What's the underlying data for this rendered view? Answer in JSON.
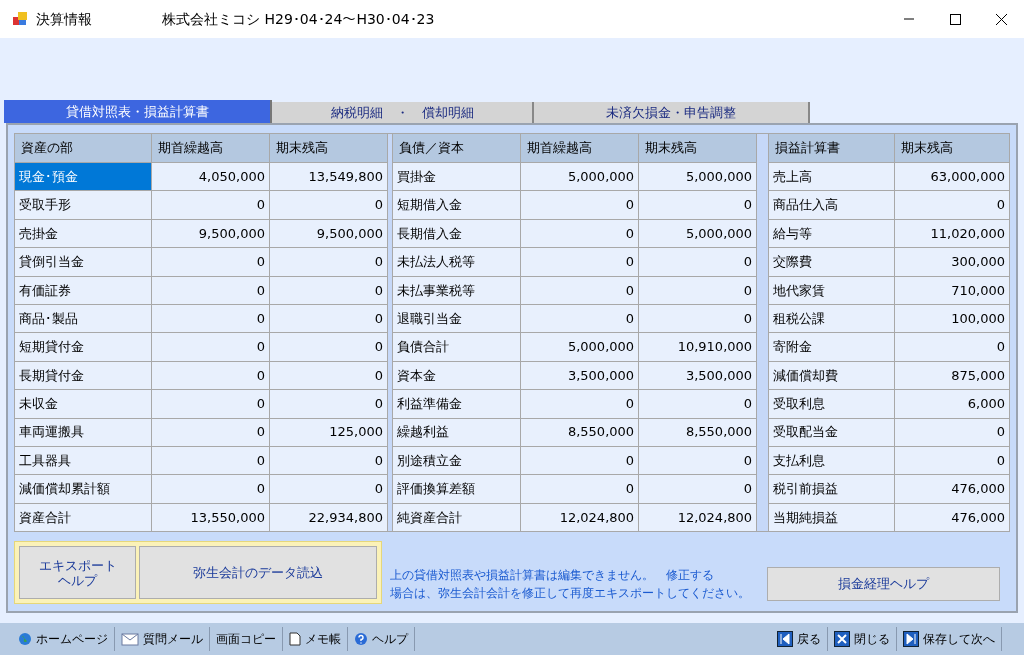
{
  "window": {
    "title": "決算情報",
    "subtitle": "株式会社ミコシ H29･04･24～H30･04･23"
  },
  "tabs": [
    {
      "label": "貸借対照表・損益計算書",
      "selected": true
    },
    {
      "label": "納税明細　・　償却明細",
      "selected": false
    },
    {
      "label": "未済欠損金・申告調整",
      "selected": false
    }
  ],
  "sections": [
    {
      "columns": [
        "資産の部",
        "期首繰越高",
        "期末残高"
      ],
      "rows": [
        {
          "name": "現金･預金",
          "values": [
            "4,050,000",
            "13,549,800"
          ],
          "selected": true
        },
        {
          "name": "受取手形",
          "values": [
            "0",
            "0"
          ],
          "selected": false
        },
        {
          "name": "売掛金",
          "values": [
            "9,500,000",
            "9,500,000"
          ],
          "selected": false
        },
        {
          "name": "貸倒引当金",
          "values": [
            "0",
            "0"
          ],
          "selected": false
        },
        {
          "name": "有価証券",
          "values": [
            "0",
            "0"
          ],
          "selected": false
        },
        {
          "name": "商品･製品",
          "values": [
            "0",
            "0"
          ],
          "selected": false
        },
        {
          "name": "短期貸付金",
          "values": [
            "0",
            "0"
          ],
          "selected": false
        },
        {
          "name": "長期貸付金",
          "values": [
            "0",
            "0"
          ],
          "selected": false
        },
        {
          "name": "未収金",
          "values": [
            "0",
            "0"
          ],
          "selected": false
        },
        {
          "name": "車両運搬具",
          "values": [
            "0",
            "125,000"
          ],
          "selected": false
        },
        {
          "name": "工具器具",
          "values": [
            "0",
            "0"
          ],
          "selected": false
        },
        {
          "name": "減価償却累計額",
          "values": [
            "0",
            "0"
          ],
          "selected": false
        },
        {
          "name": "資産合計",
          "values": [
            "13,550,000",
            "22,934,800"
          ],
          "selected": false
        }
      ]
    },
    {
      "columns": [
        "負債／資本",
        "期首繰越高",
        "期末残高"
      ],
      "rows": [
        {
          "name": "買掛金",
          "values": [
            "5,000,000",
            "5,000,000"
          ],
          "selected": false
        },
        {
          "name": "短期借入金",
          "values": [
            "0",
            "0"
          ],
          "selected": false
        },
        {
          "name": "長期借入金",
          "values": [
            "0",
            "5,000,000"
          ],
          "selected": false
        },
        {
          "name": "未払法人税等",
          "values": [
            "0",
            "0"
          ],
          "selected": false
        },
        {
          "name": "未払事業税等",
          "values": [
            "0",
            "0"
          ],
          "selected": false
        },
        {
          "name": "退職引当金",
          "values": [
            "0",
            "0"
          ],
          "selected": false
        },
        {
          "name": "負債合計",
          "values": [
            "5,000,000",
            "10,910,000"
          ],
          "selected": false
        },
        {
          "name": "資本金",
          "values": [
            "3,500,000",
            "3,500,000"
          ],
          "selected": false
        },
        {
          "name": "利益準備金",
          "values": [
            "0",
            "0"
          ],
          "selected": false
        },
        {
          "name": "繰越利益",
          "values": [
            "8,550,000",
            "8,550,000"
          ],
          "selected": false
        },
        {
          "name": "別途積立金",
          "values": [
            "0",
            "0"
          ],
          "selected": false
        },
        {
          "name": "評価換算差額",
          "values": [
            "0",
            "0"
          ],
          "selected": false
        },
        {
          "name": "純資産合計",
          "values": [
            "12,024,800",
            "12,024,800"
          ],
          "selected": false
        }
      ]
    },
    {
      "columns": [
        "損益計算書",
        "期末残高"
      ],
      "rows": [
        {
          "name": "売上高",
          "values": [
            "63,000,000"
          ],
          "selected": false
        },
        {
          "name": "商品仕入高",
          "values": [
            "0"
          ],
          "selected": false
        },
        {
          "name": "給与等",
          "values": [
            "11,020,000"
          ],
          "selected": false
        },
        {
          "name": "交際費",
          "values": [
            "300,000"
          ],
          "selected": false
        },
        {
          "name": "地代家賃",
          "values": [
            "710,000"
          ],
          "selected": false
        },
        {
          "name": "租税公課",
          "values": [
            "100,000"
          ],
          "selected": false
        },
        {
          "name": "寄附金",
          "values": [
            "0"
          ],
          "selected": false
        },
        {
          "name": "減価償却費",
          "values": [
            "875,000"
          ],
          "selected": false
        },
        {
          "name": "受取利息",
          "values": [
            "6,000"
          ],
          "selected": false
        },
        {
          "name": "受取配当金",
          "values": [
            "0"
          ],
          "selected": false
        },
        {
          "name": "支払利息",
          "values": [
            "0"
          ],
          "selected": false
        },
        {
          "name": "税引前損益",
          "values": [
            "476,000"
          ],
          "selected": false
        },
        {
          "name": "当期純損益",
          "values": [
            "476,000"
          ],
          "selected": false
        }
      ]
    }
  ],
  "buttons": {
    "export_help": "エキスポートヘルプ",
    "import": "弥生会計のデータ読込",
    "help": "損金経理ヘルプ"
  },
  "notice": [
    "上の貸借対照表や損益計算書は編集できません。　修正する",
    "場合は、弥生会計会計を修正して再度エキスポートしてください。"
  ],
  "toolbar_left": [
    {
      "kind": "globe",
      "label": "ホームページ"
    },
    {
      "kind": "mail",
      "label": "質問メール"
    },
    {
      "kind": "none",
      "label": "画面コピー"
    },
    {
      "kind": "memo",
      "label": "メモ帳"
    },
    {
      "kind": "help",
      "label": "ヘルプ"
    }
  ],
  "toolbar_right": [
    {
      "kind": "back",
      "label": "戻る"
    },
    {
      "kind": "close",
      "label": "閉じる"
    },
    {
      "kind": "next",
      "label": "保存して次へ"
    }
  ]
}
